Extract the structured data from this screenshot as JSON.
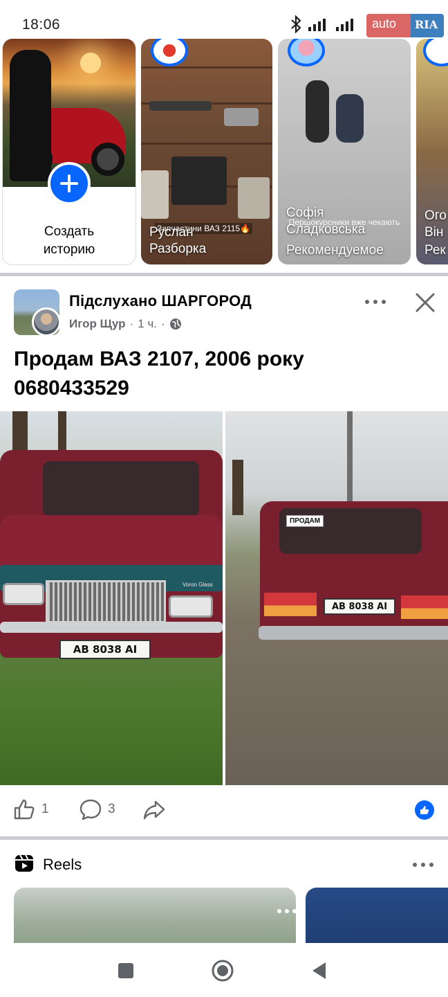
{
  "status_bar": {
    "time": "18:06",
    "icons": [
      "bluetooth-icon",
      "signal-icon",
      "signal-icon"
    ],
    "watermark_left": "auto",
    "watermark_right": "RIA"
  },
  "stories": {
    "create": {
      "label": "Создать историю",
      "icon": "plus-icon"
    },
    "items": [
      {
        "name": "Руслан Разборка",
        "caption": "Запчастини ВАЗ 2115🔥"
      },
      {
        "name": "Софія Сладковська",
        "caption": "Першокурсники вже чекають",
        "tag": "Рекомендуемое"
      },
      {
        "name": "Ого Він",
        "caption": "Рек"
      }
    ]
  },
  "post": {
    "group_name": "Підслухано ШАРГОРОД",
    "author": "Игор Щур",
    "time": "1 ч.",
    "separator": "·",
    "text_line1": "Продам ВАЗ 2107, 2006 року",
    "text_line2": "0680433529",
    "photos": [
      {
        "plate": "AB 8038 AI",
        "brand_sticker": "Voron Glass"
      },
      {
        "plate": "AB 8038 AI",
        "sign": "ПРОДАМ"
      }
    ],
    "likes": "1",
    "comments": "3"
  },
  "reels": {
    "title": "Reels"
  },
  "colors": {
    "accent": "#0866ff",
    "separator": "#c9ccd1",
    "meta_text": "#65676b"
  }
}
